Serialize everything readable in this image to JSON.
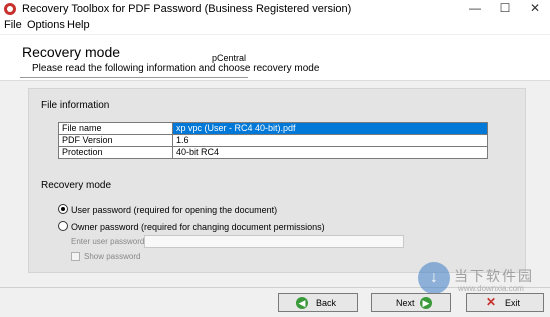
{
  "window": {
    "title": "Recovery Toolbox for PDF Password (Business Registered version)",
    "minimize": "—",
    "maximize": "☐",
    "close": "✕"
  },
  "menu": [
    "File",
    "Options",
    "Help"
  ],
  "header": {
    "title": "Recovery mode",
    "subtitle": "Please read the following information and choose recovery mode",
    "overlay": "pCentral"
  },
  "file_info": {
    "label": "File information",
    "rows": [
      {
        "key": "File name",
        "value": "xp vpc (User - RC4 40-bit).pdf"
      },
      {
        "key": "PDF Version",
        "value": "1.6"
      },
      {
        "key": "Protection",
        "value": "40-bit RC4"
      }
    ]
  },
  "recovery_mode": {
    "label": "Recovery mode",
    "options": [
      {
        "label": "User password (required for opening the document)",
        "selected": true
      },
      {
        "label": "Owner password (required for changing document permissions)",
        "selected": false
      }
    ],
    "user_password_label": "Enter user password:",
    "user_password_value": "",
    "show_password_label": "Show password",
    "show_password_checked": false
  },
  "buttons": {
    "back": "Back",
    "next": "Next",
    "exit": "Exit"
  },
  "watermark": {
    "logo": "↓",
    "text": "当下软件园",
    "url": "www.downxia.com"
  }
}
